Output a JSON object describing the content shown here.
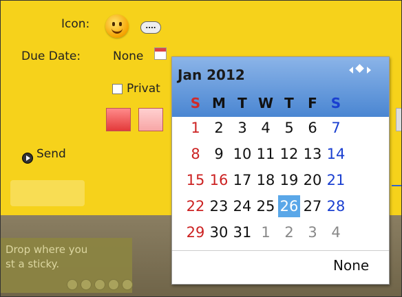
{
  "form": {
    "icon_label": "Icon:",
    "more_label": "....",
    "due_label": "Due Date:",
    "due_value": "None",
    "private_label": "Privat",
    "send_label": "Send"
  },
  "board": {
    "note_line1": "Drop where you",
    "note_line2": "st a sticky."
  },
  "calendar": {
    "month_label": "Jan 2012",
    "weekdays": [
      "S",
      "M",
      "T",
      "W",
      "T",
      "F",
      "S"
    ],
    "weeks": [
      [
        "1",
        "2",
        "3",
        "4",
        "5",
        "6",
        "7"
      ],
      [
        "8",
        "9",
        "10",
        "11",
        "12",
        "13",
        "14"
      ],
      [
        "15",
        "16",
        "17",
        "18",
        "19",
        "20",
        "21"
      ],
      [
        "22",
        "23",
        "24",
        "25",
        "26",
        "27",
        "28"
      ],
      [
        "29",
        "30",
        "31",
        "1",
        "2",
        "3",
        "4"
      ]
    ],
    "selected_day": "26",
    "none_label": "None"
  },
  "colors": {
    "panel_yellow": "#f6d21b",
    "header_blue": "#4a86d2",
    "sunday_red": "#c22",
    "saturday_blue": "#1a3fd0",
    "selected_blue": "#5aa7e8"
  },
  "icons": [
    "smiley-icon",
    "calendar-icon",
    "nav-prev-icon",
    "nav-today-icon",
    "nav-next-icon",
    "send-icon"
  ]
}
